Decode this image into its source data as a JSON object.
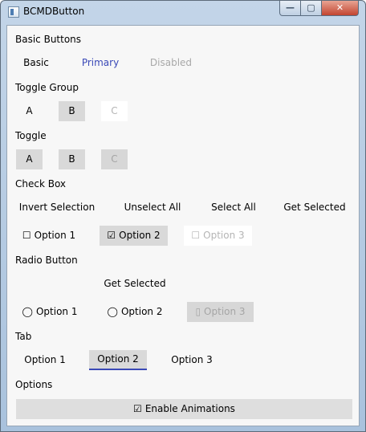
{
  "window": {
    "title": "BCMDButton",
    "controls": {
      "minimize": "—",
      "maximize": "▢",
      "close": "✕"
    }
  },
  "basic": {
    "heading": "Basic Buttons",
    "buttons": [
      "Basic",
      "Primary",
      "Disabled"
    ]
  },
  "toggle_group": {
    "heading": "Toggle Group",
    "items": [
      "A",
      "B",
      "C"
    ],
    "selected": "B",
    "disabled": "C"
  },
  "toggle": {
    "heading": "Toggle",
    "items": [
      "A",
      "B",
      "C"
    ],
    "disabled": "C"
  },
  "checkbox": {
    "heading": "Check Box",
    "actions": [
      "Invert Selection",
      "Unselect All",
      "Select All",
      "Get Selected"
    ],
    "options": [
      {
        "glyph": "☐",
        "label": "Option 1",
        "checked": false
      },
      {
        "glyph": "☑",
        "label": "Option 2",
        "checked": true
      },
      {
        "glyph": "☐",
        "label": "Option 3",
        "disabled": true
      }
    ]
  },
  "radio": {
    "heading": "Radio Button",
    "action": "Get Selected",
    "options": [
      {
        "glyph": "◯",
        "label": "Option 1"
      },
      {
        "glyph": "◯",
        "label": "Option 2"
      },
      {
        "glyph": "▯",
        "label": "Option 3",
        "disabled": true
      }
    ]
  },
  "tab": {
    "heading": "Tab",
    "items": [
      "Option 1",
      "Option 2",
      "Option 3"
    ],
    "active": "Option 2"
  },
  "options": {
    "heading": "Options",
    "enable_glyph": "☑",
    "enable_label": "Enable Animations"
  },
  "colors": {
    "accent": "#3a49b7",
    "selected_bg": "#d9d9d9",
    "disabled_text": "#a8a8a8",
    "client_bg": "#f7f7f7"
  }
}
